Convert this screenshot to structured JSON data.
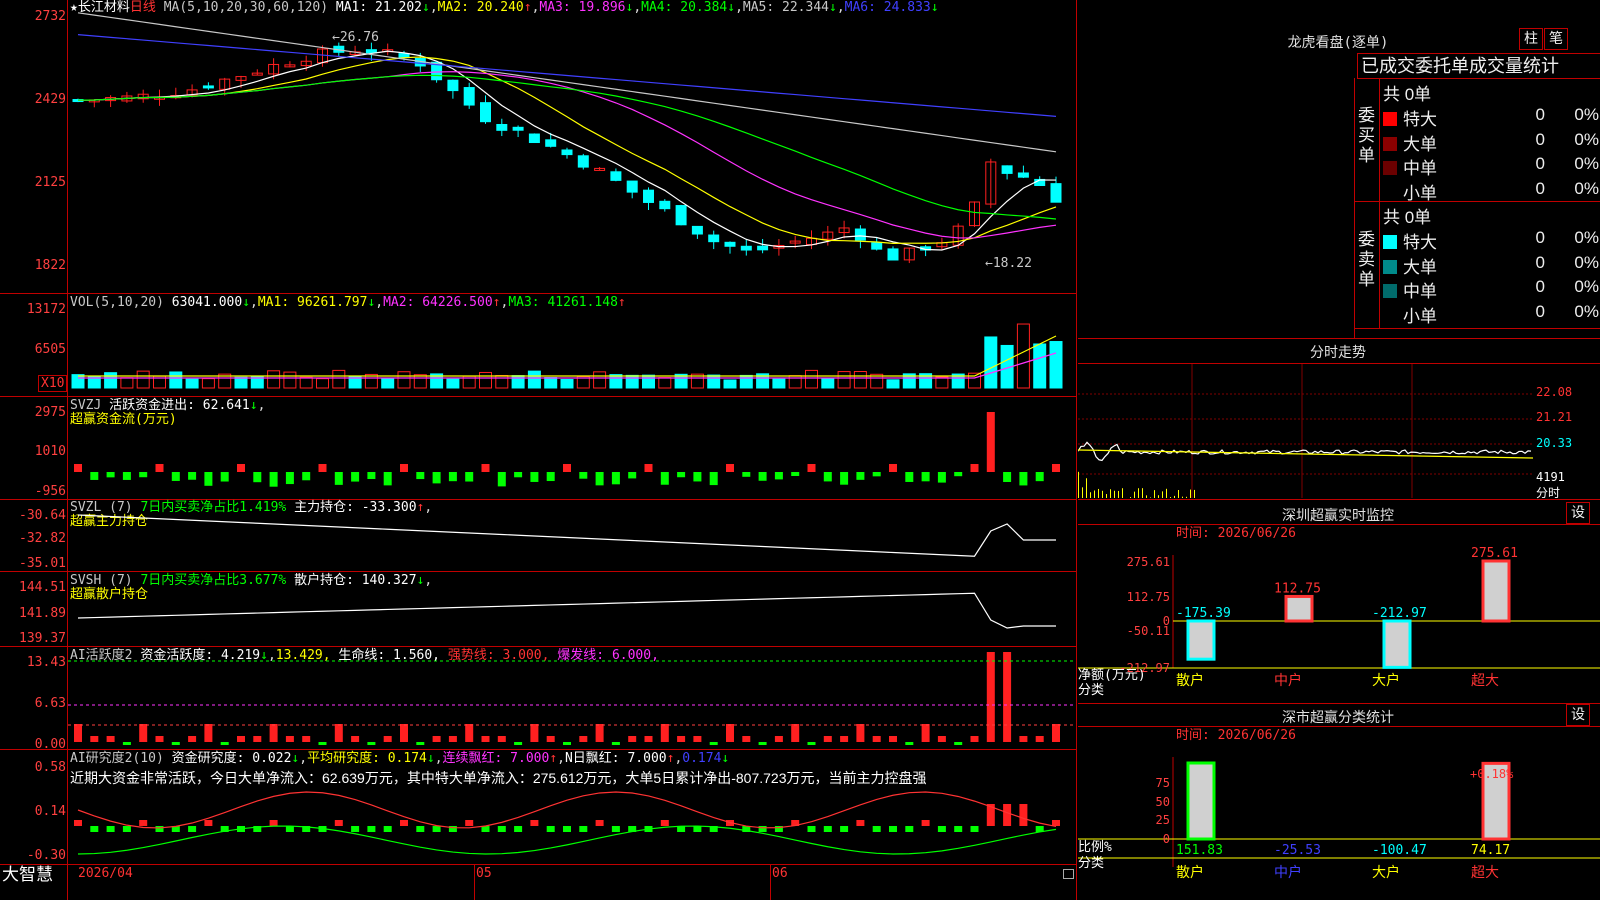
{
  "stock": {
    "name": "长江材料",
    "period": "日线",
    "star": "★"
  },
  "app_name": "大智慧",
  "main_axis": [
    "2732",
    "2429",
    "2125",
    "1822"
  ],
  "ma_header": {
    "label": "MA(5,10,20,30,60,120)",
    "ma1": "MA1: 21.202",
    "ma2": "MA2: 20.240",
    "ma3": "MA3: 19.896",
    "ma4": "MA4: 20.384",
    "ma5": "MA5: 22.344",
    "ma6": "MA6: 24.833"
  },
  "price_marks": {
    "high": "26.76",
    "low": "←18.22"
  },
  "vol": {
    "label": "VOL(5,10,20)",
    "v": "63041.000",
    "ma1": "MA1: 96261.797",
    "ma2": "MA2: 64226.500",
    "ma3": "MA3: 41261.148",
    "axis": [
      "13172",
      "6505"
    ],
    "unit": "X10"
  },
  "svzj": {
    "label": "SVZJ",
    "desc": "活跃资金进出: 62.641",
    "sub": "超赢资金流(万元)",
    "axis": [
      "2975",
      "1010",
      "-956"
    ]
  },
  "svzl": {
    "label": "SVZL (7)",
    "desc1": "7日内买卖净占比1.419%",
    "desc2": "主力持仓: -33.300",
    "sub": "超赢主力持仓",
    "axis": [
      "-30.64",
      "-32.82",
      "-35.01"
    ]
  },
  "svsh": {
    "label": "SVSH (7)",
    "desc1": "7日内买卖净占比3.677%",
    "desc2": "散户持仓: 140.327",
    "sub": "超赢散户持仓",
    "axis": [
      "144.51",
      "141.89",
      "139.37"
    ]
  },
  "ai1": {
    "label": "AI活跃度2",
    "v1": "资金活跃度: 4.219",
    "v2": "13.429,",
    "v3": "生命线: 1.560,",
    "v4": "强势线: 3.000,",
    "v5": "爆发线: 6.000,",
    "axis": [
      "13.43",
      "6.63",
      "0.00"
    ]
  },
  "ai2": {
    "label": "AI研究度2(10)",
    "v1": "资金研究度: 0.022",
    "v2": "平均研究度: 0.174",
    "v3": "连续飘红: 7.000",
    "v4": "N日飘红: 7.000",
    "v5": "0.174",
    "axis": [
      "0.58",
      "0.14",
      "-0.30"
    ],
    "note": "近期大资金非常活跃，今日大单净流入：62.639万元，其中特大单净流入：275.612万元，大单5日累计净出-807.723万元，当前主力控盘强"
  },
  "xaxis": {
    "d1": "2026/04",
    "d2": "05",
    "d3": "06"
  },
  "longhu": {
    "title": "龙虎看盘(逐单)",
    "btn1": "柱",
    "btn2": "笔",
    "subtitle": "已成交委托单成交量统计",
    "buy": {
      "label": "委买单",
      "total": "共 0单",
      "rows": [
        {
          "name": "特大",
          "n": "0",
          "p": "0%"
        },
        {
          "name": "大单",
          "n": "0",
          "p": "0%"
        },
        {
          "name": "中单",
          "n": "0",
          "p": "0%"
        },
        {
          "name": "小单",
          "n": "0",
          "p": "0%"
        }
      ]
    },
    "sell": {
      "label": "委卖单",
      "total": "共 0单",
      "rows": [
        {
          "name": "特大",
          "n": "0",
          "p": "0%"
        },
        {
          "name": "大单",
          "n": "0",
          "p": "0%"
        },
        {
          "name": "中单",
          "n": "0",
          "p": "0%"
        },
        {
          "name": "小单",
          "n": "0",
          "p": "0%"
        }
      ]
    }
  },
  "fenshi": {
    "title": "分时走势",
    "axis": [
      "22.08",
      "21.21",
      "20.33"
    ],
    "vol": "4191",
    "unit": "分时"
  },
  "sz_monitor": {
    "title": "深圳超赢实时监控",
    "btn": "设",
    "time": "时间: 2026/06/26",
    "axis": [
      "275.61",
      "112.75",
      "0",
      "-50.11",
      "-212.97"
    ],
    "bars": [
      {
        "label": "散户",
        "value": "-175.39"
      },
      {
        "label": "中户",
        "value": "112.75"
      },
      {
        "label": "大户",
        "value": "-212.97"
      },
      {
        "label": "超大",
        "value": "275.61"
      }
    ],
    "ylabel": "净额(万元)",
    "xlabel": "分类"
  },
  "sz_class": {
    "title": "深市超赢分类统计",
    "btn": "设",
    "time": "时间: 2026/06/26",
    "axis": [
      "75",
      "50",
      "25",
      "0"
    ],
    "pct": "+0.18%",
    "bars": [
      {
        "label": "散户",
        "value": "151.83"
      },
      {
        "label": "中户",
        "value": "-25.53"
      },
      {
        "label": "大户",
        "value": "-100.47"
      },
      {
        "label": "超大",
        "value": "74.17"
      }
    ],
    "ylabel": "比例%",
    "xlabel": "分类"
  },
  "colors": {
    "up": "#ff2020",
    "down": "#00ffff",
    "grid": "#c00000",
    "ma1": "#ffffff",
    "ma2": "#ffff00",
    "ma3": "#ff33ff",
    "ma4": "#00ff00",
    "ma5": "#c8c8c8",
    "ma6": "#4040ff"
  }
}
